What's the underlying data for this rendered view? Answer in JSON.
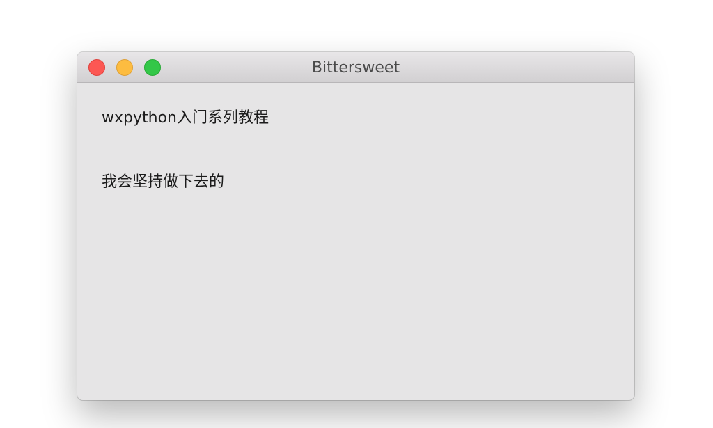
{
  "window": {
    "title": "Bittersweet",
    "traffic_lights": {
      "close_color": "#fc5753",
      "minimize_color": "#fdbc40",
      "zoom_color": "#33c748"
    }
  },
  "content": {
    "label1": "wxpython入门系列教程",
    "label2": "我会坚持做下去的"
  }
}
